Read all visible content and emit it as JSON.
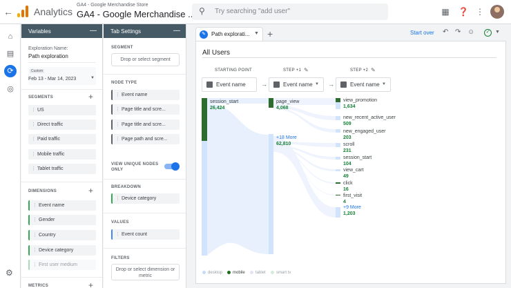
{
  "header": {
    "app_name": "Analytics",
    "account": "GA4 - Google Merchandise Store",
    "property": "GA4 - Google Merchandise ...",
    "search_placeholder": "Try searching \"add user\""
  },
  "variables": {
    "title": "Variables",
    "exploration_label": "Exploration Name:",
    "exploration_name": "Path exploration",
    "date_tag": "Custom",
    "date_range": "Feb 13 - Mar 14, 2023",
    "segments_title": "SEGMENTS",
    "segments": [
      "US",
      "Direct traffic",
      "Paid traffic",
      "Mobile traffic",
      "Tablet traffic"
    ],
    "dimensions_title": "DIMENSIONS",
    "dimensions": [
      "Event name",
      "Gender",
      "Country",
      "Device category",
      "First user medium"
    ],
    "metrics_title": "METRICS"
  },
  "tab_settings": {
    "title": "Tab Settings",
    "segment_title": "SEGMENT",
    "segment_drop": "Drop or select segment",
    "node_type_title": "NODE TYPE",
    "node_types": [
      "Event name",
      "Page title and scre...",
      "Page title and scre...",
      "Page path and scre..."
    ],
    "unique_nodes_label_1": "VIEW UNIQUE NODES",
    "unique_nodes_label_2": "ONLY",
    "breakdown_title": "BREAKDOWN",
    "breakdown_value": "Device category",
    "values_title": "VALUES",
    "values_value": "Event count",
    "filters_title": "FILTERS",
    "filters_drop_1": "Drop or select dimension or",
    "filters_drop_2": "metric"
  },
  "canvas": {
    "tab_label": "Path explorati...",
    "start_over": "Start over",
    "segment_name": "All Users",
    "col_start": "STARTING POINT",
    "col_step1": "STEP +1",
    "col_step2": "STEP +2",
    "node_select": "Event name",
    "start_node": {
      "label": "session_start",
      "value": "26,424"
    },
    "step1_nodes": [
      {
        "label": "page_view",
        "value": "4,068"
      },
      {
        "label": "+18 More",
        "value": "62,810"
      }
    ],
    "step2_nodes": [
      {
        "label": "view_promotion",
        "value": "1,634"
      },
      {
        "label": "new_recent_active_user",
        "value": "509"
      },
      {
        "label": "new_engaged_user",
        "value": "203"
      },
      {
        "label": "scroll",
        "value": "231"
      },
      {
        "label": "session_start",
        "value": "104"
      },
      {
        "label": "view_cart",
        "value": "49"
      },
      {
        "label": "click",
        "value": "16"
      },
      {
        "label": "first_visit",
        "value": "4"
      },
      {
        "label": "+9 More",
        "value": "1,203"
      }
    ],
    "legend": [
      {
        "label": "desktop",
        "color": "#c6dafc"
      },
      {
        "label": "mobile",
        "color": "#1e6b1e"
      },
      {
        "label": "tablet",
        "color": "#e6e0f8"
      },
      {
        "label": "smart tv",
        "color": "#d4ecd9"
      }
    ]
  },
  "colors": {
    "accent": "#1a73e8",
    "panel_header": "#455a64",
    "mobile": "#2e7d32",
    "desktop": "#c6dafc"
  }
}
